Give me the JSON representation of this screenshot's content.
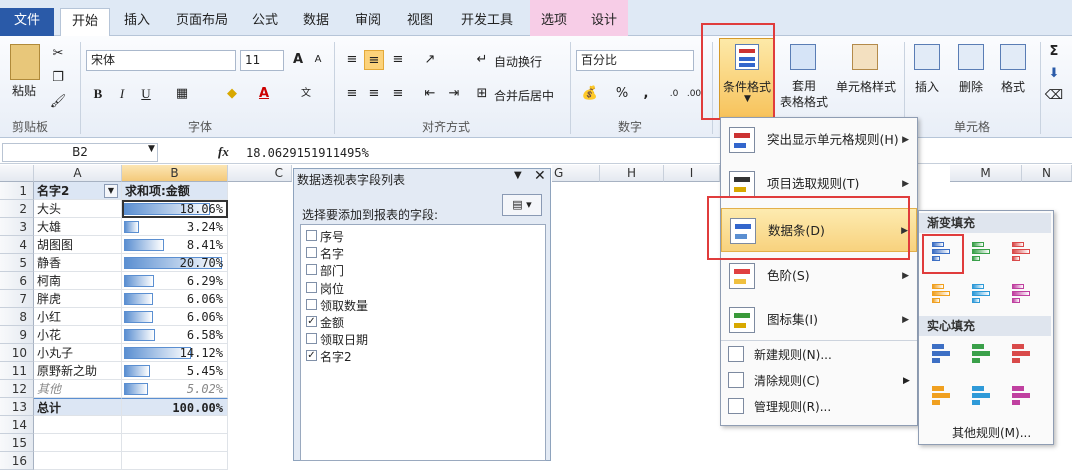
{
  "ribbon_tabs": [
    "文件",
    "开始",
    "插入",
    "页面布局",
    "公式",
    "数据",
    "审阅",
    "视图",
    "开发工具",
    "选项",
    "设计"
  ],
  "groups": {
    "clipboard": "剪贴板",
    "font": "字体",
    "align": "对齐方式",
    "number": "数字",
    "cells": "单元格"
  },
  "clipboard": {
    "paste": "粘贴"
  },
  "font": {
    "name": "宋体",
    "size": "11",
    "bold": "B",
    "italic": "I",
    "underline": "U",
    "grow": "A",
    "shrink": "A"
  },
  "align": {
    "wrap": "自动换行",
    "merge": "合并后居中"
  },
  "number": {
    "format": "百分比",
    "percent": "%",
    "comma": ","
  },
  "styles": {
    "cond": "条件格式",
    "table": "套用\n表格格式",
    "cell": "单元格样式"
  },
  "cells": {
    "insert": "插入",
    "delete": "删除",
    "format": "格式"
  },
  "formula_bar": {
    "name_box": "B2",
    "fx": "fx",
    "content": "18.0629151911495%"
  },
  "columns": [
    "A",
    "B",
    "C",
    "G",
    "H",
    "I",
    "M",
    "N"
  ],
  "pivot_rows": [
    {
      "a": "名字2",
      "b": "求和项:金额",
      "hdr": true
    },
    {
      "a": "大头",
      "b": "18.06%",
      "v": 18.06
    },
    {
      "a": "大雄",
      "b": "3.24%",
      "v": 3.24
    },
    {
      "a": "胡图图",
      "b": "8.41%",
      "v": 8.41
    },
    {
      "a": "静香",
      "b": "20.70%",
      "v": 20.7
    },
    {
      "a": "柯南",
      "b": "6.29%",
      "v": 6.29
    },
    {
      "a": "胖虎",
      "b": "6.06%",
      "v": 6.06
    },
    {
      "a": "小红",
      "b": "6.06%",
      "v": 6.06
    },
    {
      "a": "小花",
      "b": "6.58%",
      "v": 6.58
    },
    {
      "a": "小丸子",
      "b": "14.12%",
      "v": 14.12
    },
    {
      "a": "原野新之助",
      "b": "5.45%",
      "v": 5.45
    },
    {
      "a": "其他",
      "b": "5.02%",
      "v": 5.02,
      "italic": true
    },
    {
      "a": "总计",
      "b": "100.00%",
      "total": true
    }
  ],
  "row_numbers": [
    "1",
    "2",
    "3",
    "4",
    "5",
    "6",
    "7",
    "8",
    "9",
    "10",
    "11",
    "12",
    "13",
    "14",
    "15",
    "16"
  ],
  "pivot_pane": {
    "title": "数据透视表字段列表",
    "prompt": "选择要添加到报表的字段:",
    "fields": [
      {
        "name": "序号",
        "checked": false
      },
      {
        "name": "名字",
        "checked": false
      },
      {
        "name": "部门",
        "checked": false
      },
      {
        "name": "岗位",
        "checked": false
      },
      {
        "name": "领取数量",
        "checked": false
      },
      {
        "name": "金额",
        "checked": true
      },
      {
        "name": "领取日期",
        "checked": false
      },
      {
        "name": "名字2",
        "checked": true
      }
    ]
  },
  "cond_menu": {
    "items": [
      {
        "label": "突出显示单元格规则(H)"
      },
      {
        "label": "项目选取规则(T)"
      },
      {
        "label": "数据条(D)"
      },
      {
        "label": "色阶(S)"
      },
      {
        "label": "图标集(I)"
      }
    ],
    "small": [
      {
        "label": "新建规则(N)..."
      },
      {
        "label": "清除规则(C)"
      },
      {
        "label": "管理规则(R)..."
      }
    ]
  },
  "databar_menu": {
    "gradient": "渐变填充",
    "solid": "实心填充",
    "more": "其他规则(M)..."
  },
  "colors": {
    "accent": "#2a5aa8",
    "highlight": "#e03c3c",
    "bar": "#5b8fd1"
  }
}
